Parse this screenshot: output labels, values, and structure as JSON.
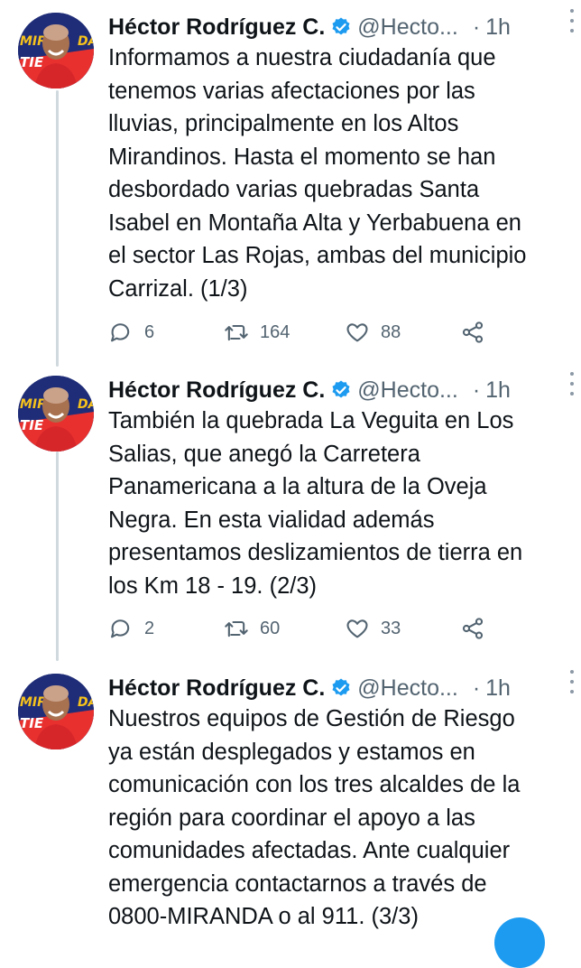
{
  "colors": {
    "accent": "#1d9bf0",
    "muted": "#536471",
    "thread_line": "#cfd9de"
  },
  "tweets": [
    {
      "name": "Héctor Rodríguez C.",
      "handle": "@Hecto...",
      "time": "1h",
      "avatar_text": [
        "MIR",
        "DA",
        "TIE"
      ],
      "lines": [
        "Informamos a nuestra ciudadanía que",
        "tenemos varias afectaciones por las",
        "lluvias, principalmente en los Altos",
        "Mirandinos. Hasta el momento se han",
        "desbordado varias quebradas Santa",
        "Isabel en Montaña Alta y Yerbabuena en",
        "el sector Las Rojas, ambas del municipio",
        "Carrizal. (1/3)"
      ],
      "replies": "6",
      "retweets": "164",
      "likes": "88"
    },
    {
      "name": "Héctor Rodríguez C.",
      "handle": "@Hecto...",
      "time": "1h",
      "avatar_text": [
        "MIR",
        "DA",
        "TIE"
      ],
      "lines": [
        "También la quebrada La Veguita en Los",
        "Salias, que anegó la Carretera",
        "Panamericana a la altura de la Oveja",
        "Negra. En esta vialidad además",
        "presentamos deslizamientos de tierra en",
        "los Km 18 - 19. (2/3)"
      ],
      "replies": "2",
      "retweets": "60",
      "likes": "33"
    },
    {
      "name": "Héctor Rodríguez C.",
      "handle": "@Hecto...",
      "time": "1h",
      "avatar_text": [
        "MIR",
        "DA",
        "TIE"
      ],
      "lines": [
        "Nuestros equipos de Gestión de Riesgo",
        "ya están desplegados y estamos en",
        "comunicación con los tres alcaldes de la",
        "región para coordinar el apoyo a las",
        "comunidades afectadas. Ante cualquier",
        "emergencia contactarnos a través de",
        "0800-MIRANDA o al 911. (3/3)"
      ]
    }
  ]
}
